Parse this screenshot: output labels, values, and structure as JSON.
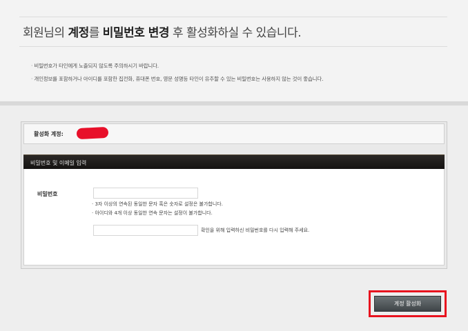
{
  "headline": {
    "prefix": "회원님의 ",
    "account_word": "계정",
    "particle": "를 ",
    "password_change": "비밀번호 변경",
    "suffix": " 후 활성화하실 수 있습니다."
  },
  "notes": [
    "비밀번호가 타인에게 노출되지 않도록 주의하시기 바랍니다.",
    "개인정보를 포함하거나 아이디를 포함한 집전화, 휴대폰 번호, 영문 성명등 타인이 유추할 수 있는 비밀번호는 사용하지 않는 것이 좋습니다."
  ],
  "account": {
    "label": "활성화 계정:"
  },
  "form": {
    "section_title": "비밀번호 및 이메일 입력",
    "password_label": "비밀번호",
    "password_value": "",
    "password_rules": [
      "3자 이상의 연속된 동일한 문자 혹은 숫자로 설정은 불가합니다.",
      "아이디와 4개 이상 동일한 연속 문자는 설정이 불가합니다."
    ],
    "confirm_value": "",
    "confirm_hint": "확인을 위해 입력하신 비밀번호를 다시 입력해 주세요."
  },
  "actions": {
    "activate_label": "계정 활성화"
  },
  "colors": {
    "highlight_red": "#e8121e",
    "header_dark": "#1f1c1a"
  }
}
